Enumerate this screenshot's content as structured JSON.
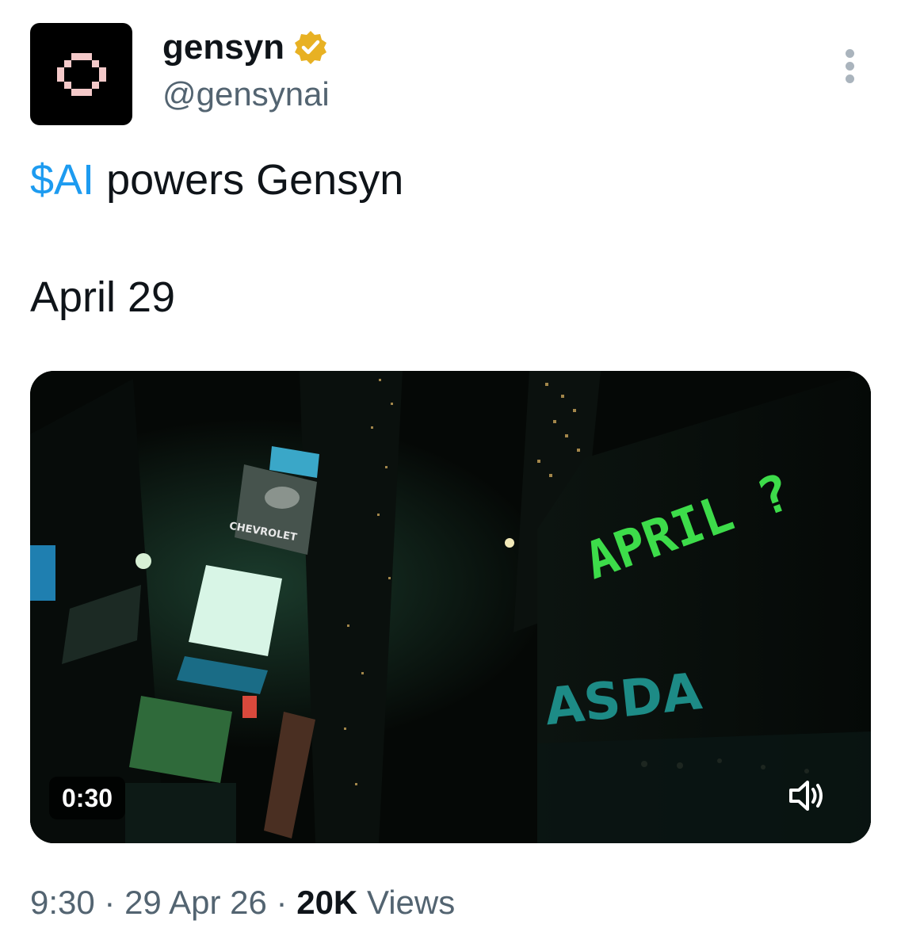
{
  "author": {
    "display_name": "gensyn",
    "handle": "@gensynai",
    "verified_badge_color": "#e8b123",
    "avatar_bg": "#000000",
    "avatar_mark_color": "#f4c9c9"
  },
  "tweet": {
    "cashtag": "$AI",
    "line1_rest": " powers Gensyn",
    "line2": "April 29",
    "link_color": "#1d9bf0"
  },
  "media": {
    "duration": "0:30",
    "sign_text": "APRIL ?",
    "sign_color": "#3ddc4a",
    "billboard_brand": "CHEVROLET",
    "nasdaq_fragment": "ASDA",
    "icons": {
      "volume": "speaker-volume-icon"
    }
  },
  "meta": {
    "time": "9:30",
    "sep1": " · ",
    "date": "29 Apr 26",
    "sep2": " · ",
    "views_count": "20K",
    "views_label": " Views"
  },
  "icons": {
    "more": "more-options-icon",
    "verified": "verified-badge-icon"
  }
}
